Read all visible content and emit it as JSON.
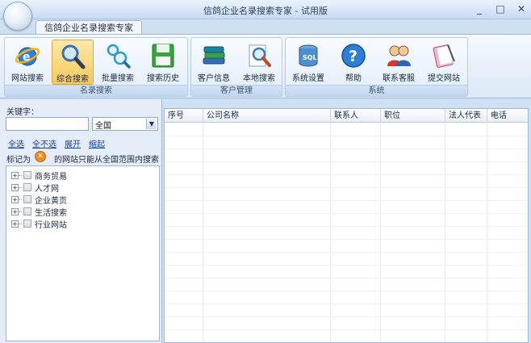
{
  "window": {
    "title": "信鸽企业名录搜索专家 - 试用版",
    "controls": [
      "_",
      "□",
      "✕"
    ]
  },
  "tabs": [
    {
      "label": "信鸽企业名录搜索专家"
    }
  ],
  "ribbon": {
    "groups": [
      {
        "label": "名录搜索",
        "buttons": [
          {
            "label": "网站搜索",
            "icon": "ie-globe-icon"
          },
          {
            "label": "综合搜索",
            "icon": "magnifier-icon",
            "active": true
          },
          {
            "label": "批量搜索",
            "icon": "batch-search-icon"
          },
          {
            "label": "搜索历史",
            "icon": "floppy-disk-icon"
          }
        ]
      },
      {
        "label": "客户管理",
        "buttons": [
          {
            "label": "客户信息",
            "icon": "books-icon"
          },
          {
            "label": "本地搜索",
            "icon": "doc-search-icon"
          }
        ]
      },
      {
        "label": "系统",
        "buttons": [
          {
            "label": "系统设置",
            "icon": "database-icon"
          },
          {
            "label": "帮助",
            "icon": "help-icon"
          },
          {
            "label": "联系客服",
            "icon": "users-icon"
          },
          {
            "label": "提交网站",
            "icon": "notebook-icon"
          }
        ]
      }
    ]
  },
  "left": {
    "keyword_label": "关键字：",
    "keyword_value": "",
    "region_value": "全国",
    "links": [
      "全选",
      "全不选",
      "展开",
      "缩起"
    ],
    "mark_prefix": "标记为",
    "mark_suffix": "的网站只能从全国范围内搜索",
    "tree": [
      "商务贸易",
      "人才网",
      "企业黄页",
      "生活搜索",
      "行业网站"
    ]
  },
  "grid": {
    "columns": [
      "序号",
      "公司名称",
      "联系人",
      "职位",
      "法人代表",
      "电话"
    ]
  },
  "colors": {
    "accent": "#f7c95c",
    "frame": "#cfe0f3",
    "mark_icon": "#f08a24"
  }
}
